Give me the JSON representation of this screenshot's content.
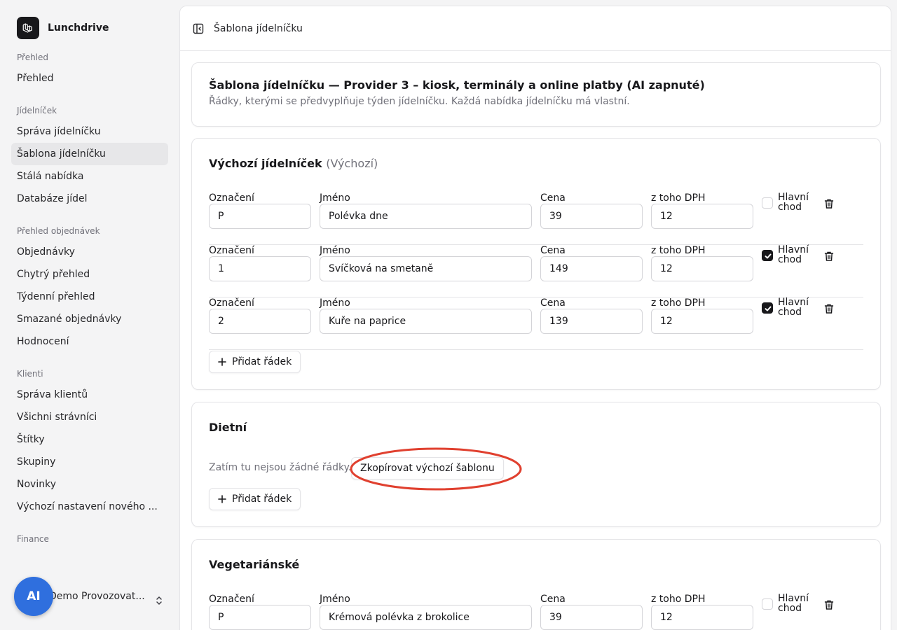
{
  "app": {
    "name": "Lunchdrive"
  },
  "sidebar": {
    "groups": [
      {
        "label": "Přehled",
        "items": [
          "Přehled"
        ]
      },
      {
        "label": "Jídelníček",
        "items": [
          "Správa jídelníčku",
          "Šablona jídelníčku",
          "Stálá nabídka",
          "Databáze jídel"
        ]
      },
      {
        "label": "Přehled objednávek",
        "items": [
          "Objednávky",
          "Chytrý přehled",
          "Týdenní přehled",
          "Smazané objednávky",
          "Hodnocení"
        ]
      },
      {
        "label": "Klienti",
        "items": [
          "Správa klientů",
          "Všichni strávníci",
          "Štítky",
          "Skupiny",
          "Novinky",
          "Výchozí nastavení nového ..."
        ]
      },
      {
        "label": "Finance",
        "items": []
      }
    ],
    "active_item": "Šablona jídelníčku",
    "user": {
      "initials": "AI",
      "name": "Demo Provozovat..."
    }
  },
  "topbar": {
    "title": "Šablona jídelníčku"
  },
  "header_card": {
    "title": "Šablona jídelníčku — Provider 3 – kiosk, terminály a online platby (AI zapnuté)",
    "description": "Řádky, kterými se předvyplňuje týden jídelníčku. Každá nabídka jídelníčku má vlastní."
  },
  "field_labels": {
    "code": "Označení",
    "name": "Jméno",
    "price": "Cena",
    "vat": "z toho DPH",
    "main_course": "Hlavní chod"
  },
  "sections": [
    {
      "title": "Výchozí jídelníček",
      "suffix": "(Výchozí)",
      "rows": [
        {
          "code": "P",
          "name": "Polévka dne",
          "price": "39",
          "vat": "12",
          "main_course": false
        },
        {
          "code": "1",
          "name": "Svíčková na smetaně",
          "price": "149",
          "vat": "12",
          "main_course": true
        },
        {
          "code": "2",
          "name": "Kuře na paprice",
          "price": "139",
          "vat": "12",
          "main_course": true
        }
      ],
      "add_row_label": "Přidat řádek"
    },
    {
      "title": "Dietní",
      "empty_text": "Zatím tu nejsou žádné řádky.",
      "copy_button_label": "Zkopírovat výchozí šablonu",
      "add_row_label": "Přidat řádek"
    },
    {
      "title": "Vegetariánské",
      "rows": [
        {
          "code": "P",
          "name": "Krémová polévka z brokolice",
          "price": "39",
          "vat": "12",
          "main_course": false
        }
      ]
    }
  ],
  "colors": {
    "accent_avatar": "#2f6fde",
    "annotation": "#e0402f",
    "primary": "#18181b"
  }
}
